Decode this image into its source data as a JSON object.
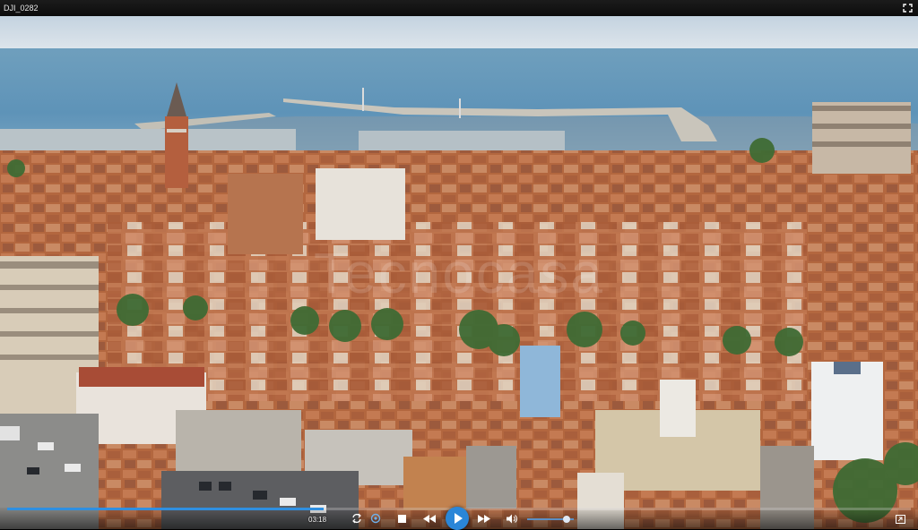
{
  "window": {
    "title": "DJI_0282"
  },
  "player": {
    "current_time": "03:18",
    "progress_fraction": 0.35,
    "volume_fraction": 0.85,
    "watermark": "Tecnocasa",
    "icons": {
      "fullscreen": "fullscreen-icon",
      "repeat": "repeat-icon",
      "settings": "settings-icon",
      "stop": "stop-icon",
      "prev": "previous-icon",
      "play": "play-icon",
      "next": "next-icon",
      "volume": "volume-icon",
      "minimize": "exit-fullscreen-icon"
    },
    "colors": {
      "accent": "#2a86d8",
      "background": "#000000"
    }
  }
}
